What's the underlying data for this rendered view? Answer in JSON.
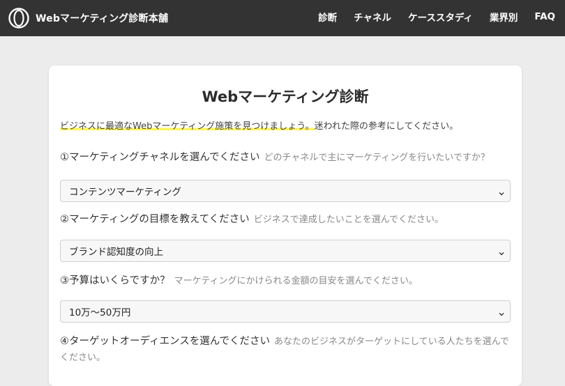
{
  "header": {
    "brand": "Webマーケティング診断本舗",
    "nav": [
      "診断",
      "チャネル",
      "ケーススタディ",
      "業界別",
      "FAQ"
    ]
  },
  "main": {
    "title": "Webマーケティング診断",
    "intro_highlight": "ビジネスに最適なWebマーケティング施策を見つけましょう。",
    "intro_rest": "迷われた際の参考にしてください。",
    "questions": [
      {
        "label": "①マーケティングチャネルを選んでください",
        "hint": "どのチャネルで主にマーケティングを行いたいですか？",
        "selected": "コンテンツマーケティング"
      },
      {
        "label": "②マーケティングの目標を教えてください",
        "hint": "ビジネスで達成したいことを選んでください。",
        "selected": "ブランド認知度の向上"
      },
      {
        "label": "③予算はいくらですか？",
        "hint": "マーケティングにかけられる金額の目安を選んでください。",
        "selected": "10万〜50万円"
      },
      {
        "label": "④ターゲットオーディエンスを選んでください",
        "hint": "あなたのビジネスがターゲットにしている人たちを選んでください。"
      }
    ]
  },
  "colors": {
    "header_bg": "#333333",
    "page_bg": "#ececec",
    "highlight": "#fff45c"
  },
  "icons": {
    "logo": "ring-logo-icon",
    "select_arrow": "chevron-down-icon"
  }
}
